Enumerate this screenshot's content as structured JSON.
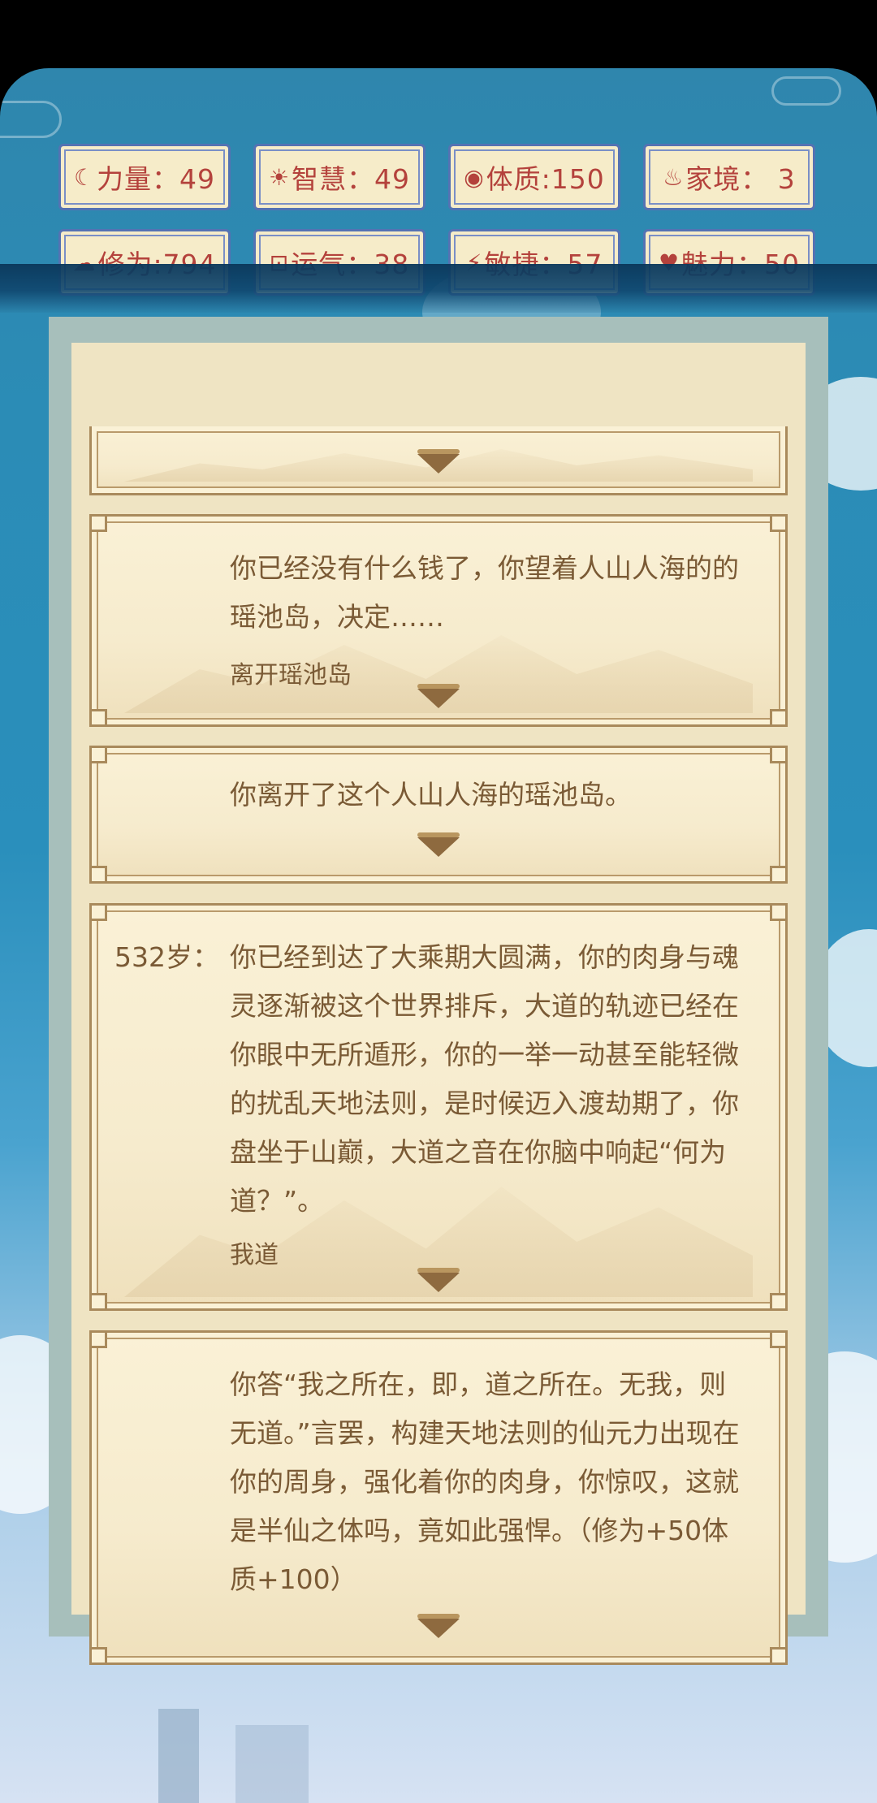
{
  "stats": [
    {
      "icon": "strength-icon",
      "glyph": "☾",
      "label": "力量：49"
    },
    {
      "icon": "wisdom-icon",
      "glyph": "☀",
      "label": "智慧：49"
    },
    {
      "icon": "constitution-icon",
      "glyph": "◉",
      "label": "体质:150"
    },
    {
      "icon": "family-icon",
      "glyph": "♨",
      "label": "家境： 3"
    },
    {
      "icon": "cultivation-icon",
      "glyph": "☁",
      "label": "修为:794"
    },
    {
      "icon": "luck-icon",
      "glyph": "⊡",
      "label": "运气：38"
    },
    {
      "icon": "agility-icon",
      "glyph": "⚡",
      "label": "敏捷：57"
    },
    {
      "icon": "charm-icon",
      "glyph": "♥",
      "label": "魅力：50"
    }
  ],
  "events": [
    {
      "age": "",
      "text": "",
      "choice": ""
    },
    {
      "age": "",
      "text": "你已经没有什么钱了，你望着人山人海的的瑶池岛，决定……",
      "choice": "离开瑶池岛"
    },
    {
      "age": "",
      "text": "你离开了这个人山人海的瑶池岛。",
      "choice": ""
    },
    {
      "age": "532岁：",
      "text": "你已经到达了大乘期大圆满，你的肉身与魂灵逐渐被这个世界排斥，大道的轨迹已经在你眼中无所遁形，你的一举一动甚至能轻微的扰乱天地法则，是时候迈入渡劫期了，你盘坐于山巅，大道之音在你脑中响起“何为道？”。",
      "choice": "我道"
    },
    {
      "age": "",
      "text": "你答“我之所在，即，道之所在。无我，则无道。”言罢，构建天地法则的仙元力出现在你的周身，强化着你的肉身，你惊叹，这就是半仙之体吗，竟如此强悍。（修为+50体质+100）",
      "choice": ""
    }
  ],
  "colors": {
    "stat_text": "#b4423c",
    "stat_border": "#5472b3",
    "card_text": "#7a5a35",
    "card_border": "#a98a5c"
  }
}
